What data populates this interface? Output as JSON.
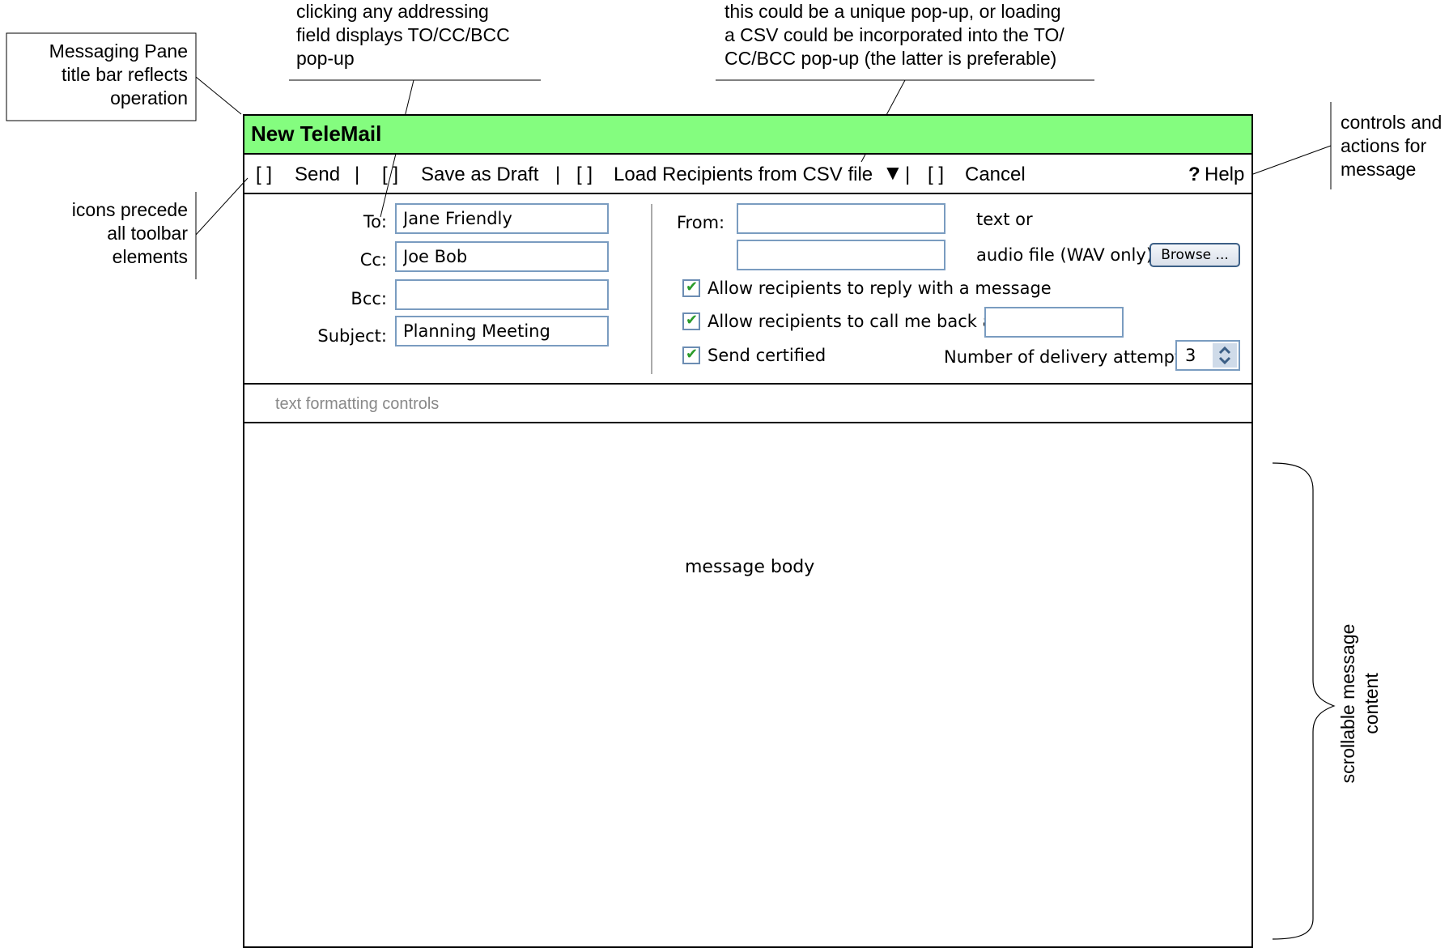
{
  "annotations": {
    "title_note": [
      "Messaging Pane",
      "title bar reflects",
      "operation"
    ],
    "addressing_note": [
      "clicking any addressing",
      "field displays TO/CC/BCC",
      "pop-up"
    ],
    "csv_note": [
      "this could be a unique pop-up, or loading",
      "a CSV could be incorporated into the TO/",
      "CC/BCC pop-up (the latter is preferable)"
    ],
    "controls_note": [
      "controls and",
      "actions for",
      "message"
    ],
    "icons_note": [
      "icons precede",
      "all toolbar",
      "elements"
    ],
    "scroll_note": [
      "scrollable message",
      "content"
    ]
  },
  "window": {
    "title": "New TeleMail"
  },
  "toolbar": {
    "icon_placeholder": "[ ]",
    "separator": "|",
    "send_label": "Send",
    "save_draft_label": "Save as Draft",
    "load_csv_label": "Load Recipients from CSV file",
    "dropdown_glyph": "▼",
    "cancel_label": "Cancel",
    "help_glyph": "?",
    "help_label": "Help"
  },
  "fields": {
    "to_label": "To:",
    "to_value": "Jane Friendly",
    "cc_label": "Cc:",
    "cc_value": "Joe Bob",
    "bcc_label": "Bcc:",
    "bcc_value": "",
    "subject_label": "Subject:",
    "subject_value": "Planning Meeting",
    "from_label": "From:",
    "from_text_value": "",
    "from_audio_value": "",
    "text_or_label": "text or",
    "audio_label": "audio file (WAV only)",
    "browse_label": "Browse ...",
    "allow_reply_label": "Allow recipients to reply with a message",
    "allow_reply_checked": true,
    "allow_callback_label": "Allow recipients to call me back at:",
    "allow_callback_checked": true,
    "callback_value": "",
    "send_certified_label": "Send certified",
    "send_certified_checked": true,
    "attempts_label": "Number of delivery attempts:",
    "attempts_value": "3",
    "check_glyph": "✔"
  },
  "formatting": {
    "placeholder": "text formatting controls"
  },
  "body": {
    "placeholder": "message body"
  },
  "colors": {
    "titlebar": "#84fd7f",
    "input_border": "#7a9cc0",
    "check": "#2a9b2a"
  }
}
